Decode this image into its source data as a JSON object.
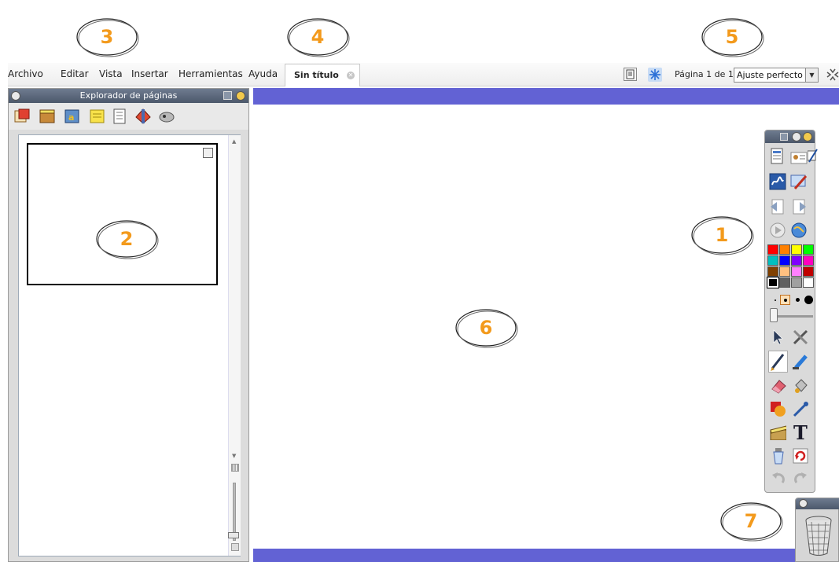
{
  "callouts": [
    "1",
    "2",
    "3",
    "4",
    "5",
    "6",
    "7"
  ],
  "menu": {
    "items": [
      "Archivo",
      "Editar",
      "Vista",
      "Insertar",
      "Herramientas",
      "Ayuda"
    ]
  },
  "document_tab": {
    "title": "Sin título"
  },
  "page_status": {
    "label": "Página 1 de 1",
    "zoom_value": "Ajuste perfecto"
  },
  "page_explorer": {
    "title": "Explorador de páginas"
  },
  "colors": {
    "workspace_bar": "#6262d4",
    "callout_number": "#f39a1c",
    "panel_header": "#4c586b",
    "palette": [
      "#ff0000",
      "#ff8000",
      "#ffff00",
      "#00ff00",
      "#00c0c0",
      "#0000ff",
      "#8000ff",
      "#ff00c0",
      "#804000",
      "#ffc080",
      "#ff80ff",
      "#c00000",
      "#000000",
      "#606060",
      "#a0a0a0",
      "#ffffff"
    ]
  },
  "icons": {
    "toolbox": [
      "page-sorter-icon",
      "user-icon",
      "signature-icon",
      "handwriting-icon",
      "tools-icon",
      "back-arrow-icon",
      "forward-arrow-icon",
      "play-icon",
      "globe-icon",
      "select-arrow-icon",
      "magic-tools-icon",
      "pen-icon",
      "highlighter-icon",
      "eraser-icon",
      "fill-bucket-icon",
      "shapes-icon",
      "connector-icon",
      "clapper-icon",
      "text-icon",
      "clear-icon",
      "reset-icon",
      "undo-icon",
      "redo-icon"
    ]
  }
}
